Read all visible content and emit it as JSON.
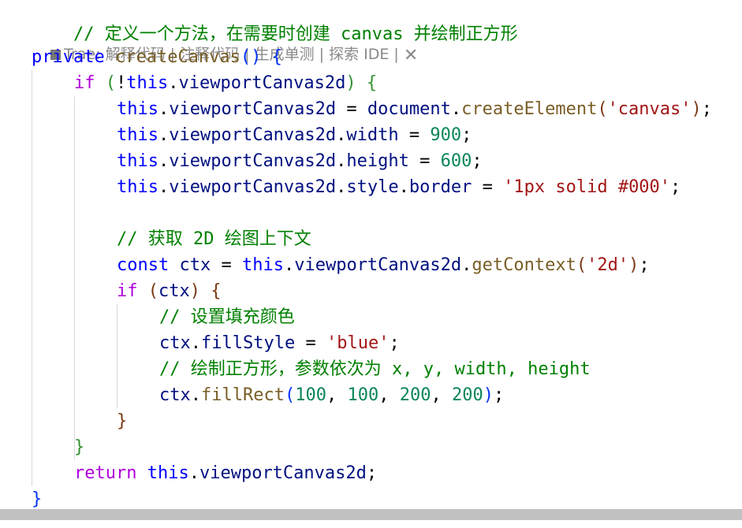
{
  "editor": {
    "code_lens": {
      "prefix": "Trae:",
      "items": [
        "解释代码",
        "注释代码",
        "生成单测",
        "探索 IDE"
      ],
      "separator": " | ",
      "close": "✕"
    },
    "tokens": {
      "l0_comment": "// 定义一个方法，在需要时创建 canvas 并绘制正方形",
      "l1_private": "private",
      "l1_fn": "createCanvas",
      "l1_parens": "()",
      "l1_brace": "{",
      "l2_if": "if",
      "l2_lp": "(",
      "l2_not": "!",
      "l2_this": "this",
      "l2_dot": ".",
      "l2_prop": "viewportCanvas2d",
      "l2_rp": ")",
      "l2_brace": "{",
      "l3_this": "this",
      "l3_prop": "viewportCanvas2d",
      "l3_eq": " = ",
      "l3_doc": "document",
      "l3_fn": "createElement",
      "l3_lp": "(",
      "l3_str": "'canvas'",
      "l3_rp": ")",
      "l3_semi": ";",
      "l4_this": "this",
      "l4_prop": "viewportCanvas2d",
      "l4_width": "width",
      "l4_num": "900",
      "l5_this": "this",
      "l5_prop": "viewportCanvas2d",
      "l5_height": "height",
      "l5_num": "600",
      "l6_this": "this",
      "l6_prop": "viewportCanvas2d",
      "l6_style": "style",
      "l6_border": "border",
      "l6_str": "'1px solid #000'",
      "l8_comment": "// 获取 2D 绘图上下文",
      "l9_const": "const",
      "l9_ctx": "ctx",
      "l9_this": "this",
      "l9_prop": "viewportCanvas2d",
      "l9_fn": "getContext",
      "l9_str": "'2d'",
      "l10_if": "if",
      "l10_ctx": "ctx",
      "l11_comment": "// 设置填充颜色",
      "l12_ctx": "ctx",
      "l12_prop": "fillStyle",
      "l12_str": "'blue'",
      "l13_comment": "// 绘制正方形，参数依次为 x, y, width, height",
      "l14_ctx": "ctx",
      "l14_fn": "fillRect",
      "l14_n1": "100",
      "l14_n2": "100",
      "l14_n3": "200",
      "l14_n4": "200",
      "l15_brace": "}",
      "l16_brace": "}",
      "l17_return": "return",
      "l17_this": "this",
      "l17_prop": "viewportCanvas2d",
      "l18_brace": "}"
    }
  },
  "colors": {
    "keyword_blue": "#0000ff",
    "control_purple": "#af00db",
    "variable": "#001080",
    "function": "#795e26",
    "string": "#a31515",
    "number": "#098658",
    "comment": "#008000"
  }
}
